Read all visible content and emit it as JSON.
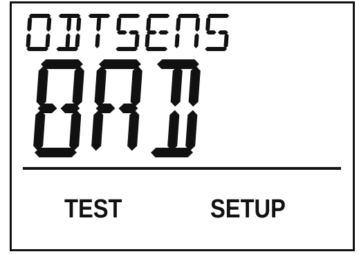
{
  "display": {
    "status_text": "ODTSENS",
    "value_text": "BAD",
    "segment_color": "#111111",
    "background_color": "#ffffff"
  },
  "softkeys": {
    "left_label": "TEST",
    "right_label": "SETUP"
  }
}
